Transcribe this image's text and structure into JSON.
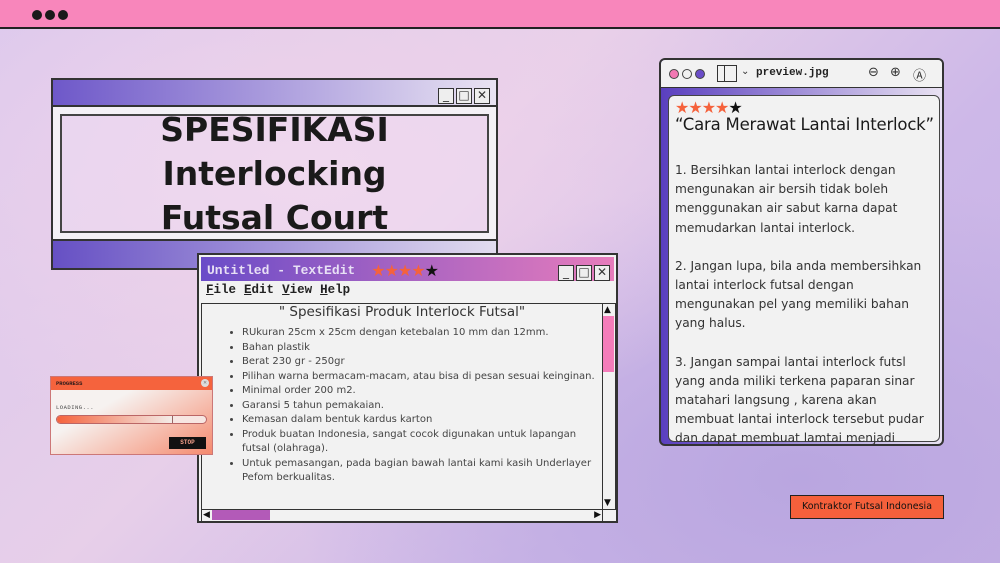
{
  "title_window": {
    "heading_line1": "SPESIFIKASI Interlocking",
    "heading_line2": "Futsal Court"
  },
  "textedit": {
    "title": "Untitled - TextEdit",
    "rating": {
      "filled": 4,
      "total": 5
    },
    "menu": [
      {
        "key": "F",
        "rest": "ile"
      },
      {
        "key": "E",
        "rest": "dit"
      },
      {
        "key": "V",
        "rest": "iew"
      },
      {
        "key": "H",
        "rest": "elp"
      }
    ],
    "doc_title": "\" Spesifikasi Produk Interlock Futsal\"",
    "items": [
      "RUkuran 25cm x 25cm dengan ketebalan 10 mm dan 12mm.",
      "Bahan plastik",
      "Berat 230 gr - 250gr",
      "Pilihan warna bermacam-macam, atau bisa di pesan sesuai keinginan.",
      "Minimal order 200 m2.",
      "Garansi 5 tahun pemakaian.",
      "Kemasan dalam bentuk kardus karton",
      "Produk buatan Indonesia, sangat cocok digunakan untuk lapangan futsal (olahraga).",
      "Untuk pemasangan, pada bagian bawah lantai kami kasih Underlayer Pefom berkualitas."
    ]
  },
  "progress": {
    "title": "PROGRESS",
    "label": "LOADING...",
    "percent": 78,
    "stop_label": "STOP"
  },
  "preview": {
    "filename": "preview.jpg",
    "rating": {
      "filled": 4,
      "total": 5
    },
    "heading": "“Cara Merawat Lantai Interlock”",
    "paragraphs": [
      "1. Bersihkan lantai interlock dengan mengunakan air bersih tidak boleh menggunakan air sabut karna dapat memudarkan lantai interlock.",
      "2. Jangan lupa, bila anda membersihkan lantai interlock futsal dengan mengunakan pel yang memiliki bahan yang halus.",
      "3. Jangan sampai lantai interlock futsl yang anda miliki terkena paparan sinar matahari langsung , karena akan membuat lantai interlock tersebut pudar dan dapat membuat lamtai menjadi rapuh."
    ]
  },
  "cta_label": "Kontraktor Futsal Indonesia",
  "colors": {
    "topbar": "#f886bb",
    "accent_orange": "#f5623c",
    "purple": "#6a4cc8"
  }
}
